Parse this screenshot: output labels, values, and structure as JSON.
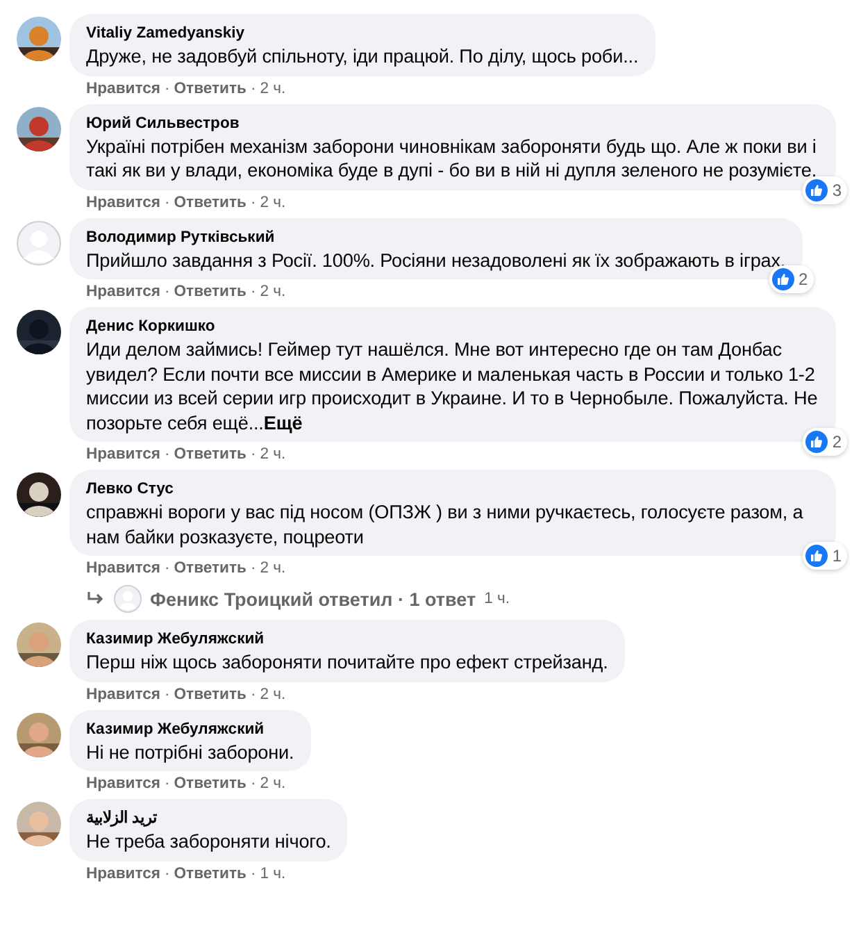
{
  "separator": "·",
  "comments": [
    {
      "author": "Vitaliy Zamedyanskiy",
      "text": "Друже, не задовбуй спільноту, іди працюй. По ділу, щось роби...",
      "actions": [
        "Нравится",
        "Ответить"
      ],
      "time": "2 ч."
    },
    {
      "author": "Юрий Сильвестров",
      "text": "Україні потрібен механізм заборони чиновнікам забороняти будь що. Але ж поки ви і такі як ви у влади, економіка буде в дупі - бо ви в ній ні дупля зеленого не розумієте.",
      "actions": [
        "Нравится",
        "Ответить"
      ],
      "time": "2 ч.",
      "reactions": "3"
    },
    {
      "author": "Володимир Рутківський",
      "avatar": {
        "kind": "blank"
      },
      "text": "Прийшло завдання з Росії. 100%. Росіяни незадоволені як їх зображають в іграх.",
      "actions": [
        "Нравится",
        "Ответить"
      ],
      "time": "2 ч.",
      "reactions": "2"
    },
    {
      "author": "Денис Коркишко",
      "text": "Иди делом займись! Геймер тут нашёлся. Мне вот интересно где он там Донбас увидел? Если почти все миссии в Америке и маленькая часть в России и только 1-2 миссии из всей серии игр происходит в Украине. И то в Чернобыле. Пожалуйста. Не позорьте себя ещё...",
      "more": "Ещё",
      "actions": [
        "Нравится",
        "Ответить"
      ],
      "time": "2 ч.",
      "reactions": "2"
    },
    {
      "author": "Левко Стус",
      "text": "справжні вороги у вас під носом (ОПЗЖ ) ви з ними ручкаєтесь, голосуєте разом, а нам байки розказуєте, поцреоти",
      "actions": [
        "Нравится",
        "Ответить"
      ],
      "time": "2 ч.",
      "reactions": "1",
      "replies": {
        "text": "Феникс Троицкий ответил",
        "count": "1 ответ",
        "time": "1 ч."
      }
    },
    {
      "author": "Казимир Жебуляжский",
      "text": "Перш ніж щось забороняти почитайте про ефект стрейзанд.",
      "actions": [
        "Нравится",
        "Ответить"
      ],
      "time": "2 ч."
    },
    {
      "author": "Казимир Жебуляжский",
      "text": "Ні не потрібні заборони.",
      "actions": [
        "Нравится",
        "Ответить"
      ],
      "time": "2 ч."
    },
    {
      "author": "تريد الزلابية",
      "text": "Не треба забороняти нічого.",
      "actions": [
        "Нравится",
        "Ответить"
      ],
      "time": "1 ч."
    }
  ]
}
